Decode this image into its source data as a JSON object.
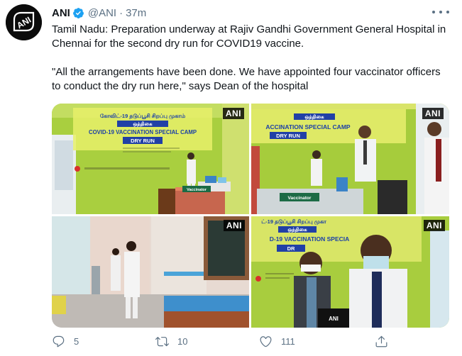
{
  "tweet": {
    "author": {
      "name": "ANI",
      "handle": "@ANI",
      "verified": true,
      "avatar_icon": "ani-logo-icon",
      "avatar_text": "ANI"
    },
    "separator": "·",
    "time": "37m",
    "paragraphs": [
      "Tamil Nadu: Preparation underway at Rajiv Gandhi Government General Hospital in Chennai for the second dry run for COVID19 vaccine.",
      "\"All the arrangements have been done. We have appointed four vaccinator officers to conduct the dry run here,\" says Dean of the hospital"
    ],
    "media": [
      {
        "watermark": "ANI",
        "banner_lines": [
          "கோவிட்-19 தடுப்பூசி சிறப்பு முகாம்",
          "ஒத்திகை",
          "COVID-19 VACCINATION SPECIAL CAMP",
          "DRY RUN"
        ],
        "desk_sign": "Vaccinator"
      },
      {
        "watermark": "ANI",
        "banner_lines": [
          "ஒத்திகை",
          "ACCINATION SPECIAL CAMP",
          "DRY RUN"
        ],
        "desk_sign": "Vaccinator"
      },
      {
        "watermark": "ANI"
      },
      {
        "watermark": "ANI",
        "banner_lines": [
          "ட்-19 தடுப்பூசி சிறப்பு முகா",
          "ஒத்திகை",
          "D-19 VACCINATION SPECIA",
          "DR"
        ],
        "mic_label": "ANI"
      }
    ],
    "actions": {
      "reply_count": "5",
      "retweet_count": "10",
      "like_count": "111"
    }
  },
  "colors": {
    "accent_blue": "#1da1f2",
    "secondary_text": "#5b7083",
    "wall_green": "#b6d94a",
    "banner_blue": "#1a3fa8"
  }
}
